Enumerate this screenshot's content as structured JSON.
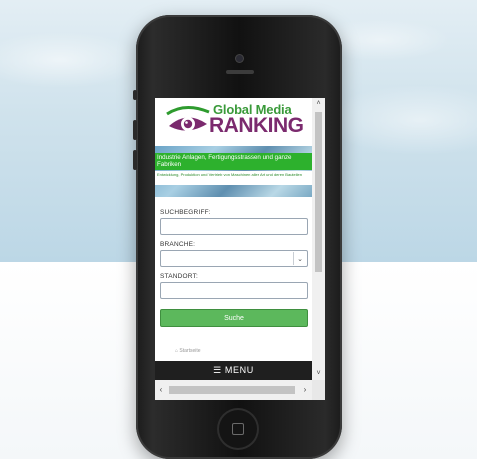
{
  "logo": {
    "line1": "Global Media",
    "line2": "RANKING"
  },
  "banner": {
    "title": "Industrie Anlagen, Fertigungsstrassen und ganze Fabriken",
    "subtitle": "Entwicklung, Produktion und Vertrieb von Maschinen aller Art und deren Bauteilen"
  },
  "form": {
    "search_label": "SUCHBEGRIFF:",
    "search_value": "",
    "branch_label": "BRANCHE:",
    "branch_value": "",
    "location_label": "STANDORT:",
    "location_value": "",
    "submit_label": "Suche"
  },
  "breadcrumb": {
    "home_label": "Startseite"
  },
  "menu": {
    "label": "☰  MENU"
  },
  "icons": {
    "select_arrow": "chevron-down-icon",
    "scroll_up": "chevron-up-icon",
    "scroll_down": "chevron-down-icon",
    "scroll_left": "chevron-left-icon",
    "scroll_right": "chevron-right-icon",
    "home": "home-icon"
  },
  "colors": {
    "brand_green": "#2db12d",
    "brand_purple": "#7b2a6e",
    "button_green": "#5cb85c",
    "menu_bg": "#1f1f1f"
  }
}
